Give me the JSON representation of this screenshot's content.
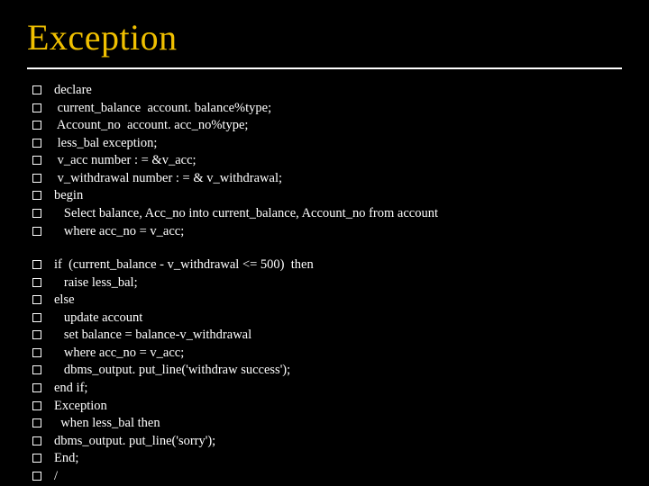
{
  "title": "Exception",
  "block1": [
    "declare",
    " current_balance  account. balance%type;",
    " Account_no  account. acc_no%type;",
    " less_bal exception;",
    " v_acc number : = &v_acc;",
    " v_withdrawal number : = & v_withdrawal;",
    "begin",
    "   Select balance, Acc_no into current_balance, Account_no from account",
    "   where acc_no = v_acc;"
  ],
  "block2": [
    "if  (current_balance - v_withdrawal <= 500)  then",
    "   raise less_bal;",
    "else",
    "   update account",
    "   set balance = balance-v_withdrawal",
    "   where acc_no = v_acc;",
    "   dbms_output. put_line('withdraw success');",
    "end if;",
    "Exception",
    "  when less_bal then",
    "dbms_output. put_line('sorry');",
    "End;",
    "/"
  ]
}
